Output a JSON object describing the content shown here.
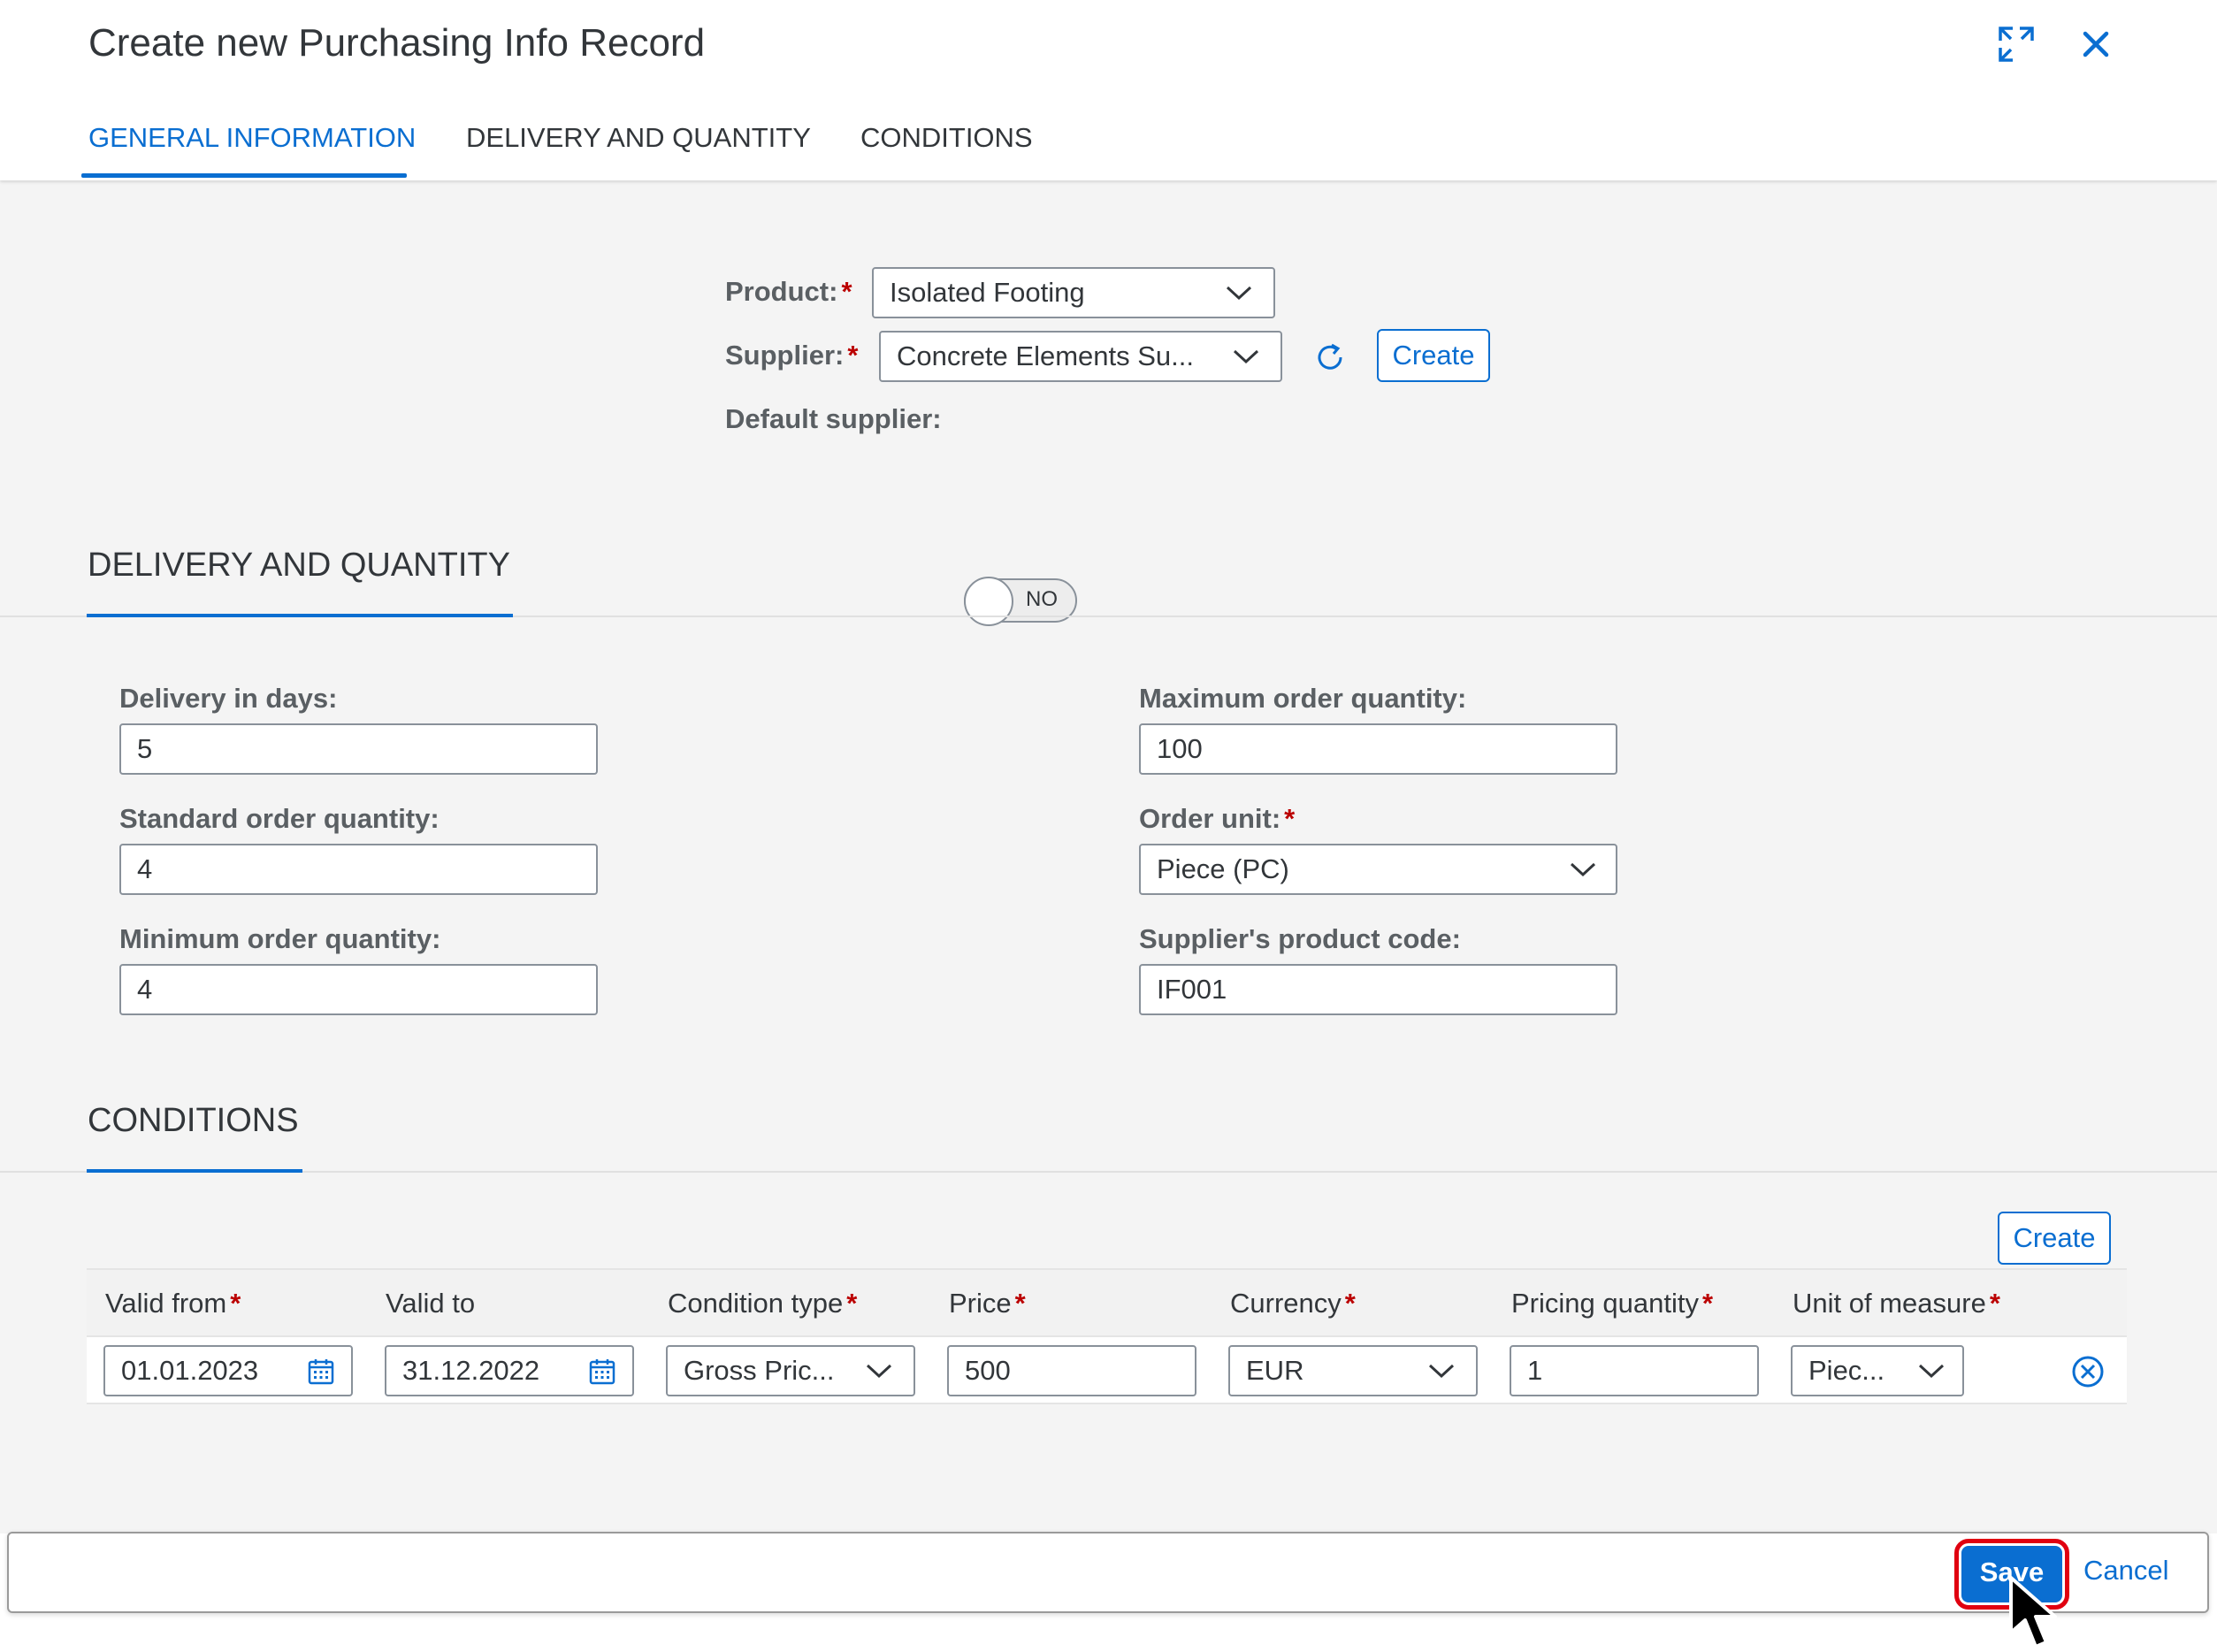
{
  "dialog": {
    "title": "Create new Purchasing Info Record",
    "tabs": [
      {
        "label": "GENERAL INFORMATION",
        "active": true
      },
      {
        "label": "DELIVERY AND QUANTITY",
        "active": false
      },
      {
        "label": "CONDITIONS",
        "active": false
      }
    ],
    "icons": {
      "expand": "expand-icon",
      "close": "close-icon"
    }
  },
  "general": {
    "product_label": "Product:",
    "product_value": "Isolated Footing",
    "supplier_label": "Supplier:",
    "supplier_value": "Concrete Elements Su...",
    "create_label": "Create",
    "default_supplier_label": "Default supplier:",
    "default_supplier_toggle": "NO"
  },
  "delivery": {
    "section_title": "DELIVERY AND QUANTITY",
    "delivery_days_label": "Delivery in days:",
    "delivery_days_value": "5",
    "standard_qty_label": "Standard order quantity:",
    "standard_qty_value": "4",
    "minimum_qty_label": "Minimum order quantity:",
    "minimum_qty_value": "4",
    "maximum_qty_label": "Maximum order quantity:",
    "maximum_qty_value": "100",
    "order_unit_label": "Order unit:",
    "order_unit_value": "Piece (PC)",
    "supplier_code_label": "Supplier's product code:",
    "supplier_code_value": "IF001"
  },
  "conditions": {
    "section_title": "CONDITIONS",
    "create_label": "Create",
    "columns": [
      "Valid from",
      "Valid to",
      "Condition type",
      "Price",
      "Currency",
      "Pricing quantity",
      "Unit of measure"
    ],
    "row": {
      "valid_from": "01.01.2023",
      "valid_to": "31.12.2022",
      "condition_type": "Gross Pric...",
      "price": "500",
      "currency": "EUR",
      "pricing_quantity": "1",
      "unit_of_measure": "Piec..."
    }
  },
  "footer": {
    "save_label": "Save",
    "cancel_label": "Cancel"
  },
  "colors": {
    "accent": "#0a6ed1",
    "required": "#bb0000",
    "highlight": "#e00010"
  }
}
